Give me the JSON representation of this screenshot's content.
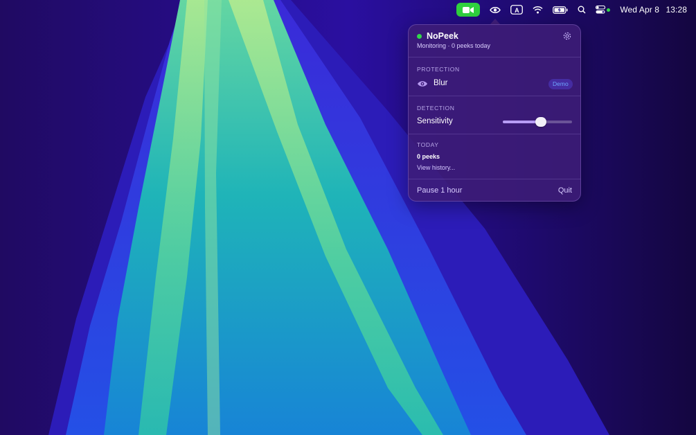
{
  "menubar": {
    "items": [
      {
        "icon": "video-camera-icon"
      },
      {
        "icon": "eye-icon"
      },
      {
        "icon": "input-source-icon",
        "label": "A"
      },
      {
        "icon": "wifi-icon"
      },
      {
        "icon": "battery-charging-icon"
      },
      {
        "icon": "spotlight-search-icon"
      },
      {
        "icon": "control-center-icon"
      }
    ],
    "clock": {
      "date": "Wed Apr 8",
      "time": "13:28"
    }
  },
  "popover": {
    "app_name": "NoPeek",
    "status": "Monitoring · 0 peeks today",
    "protection": {
      "title": "PROTECTION",
      "mode_label": "Blur",
      "badge": "Demo"
    },
    "detection": {
      "title": "DETECTION",
      "sensitivity_label": "Sensitivity",
      "sensitivity_level": 0.55
    },
    "today": {
      "title": "TODAY",
      "peeks": "0 peeks",
      "history_link": "View history..."
    },
    "footer": {
      "pause_label": "Pause 1 hour",
      "quit_label": "Quit"
    }
  },
  "colors": {
    "accent_green": "#32d74b",
    "camera_pill": "#2fd13e",
    "popover_bg": "#3e1c76",
    "badge_text": "#6fa6ff"
  }
}
